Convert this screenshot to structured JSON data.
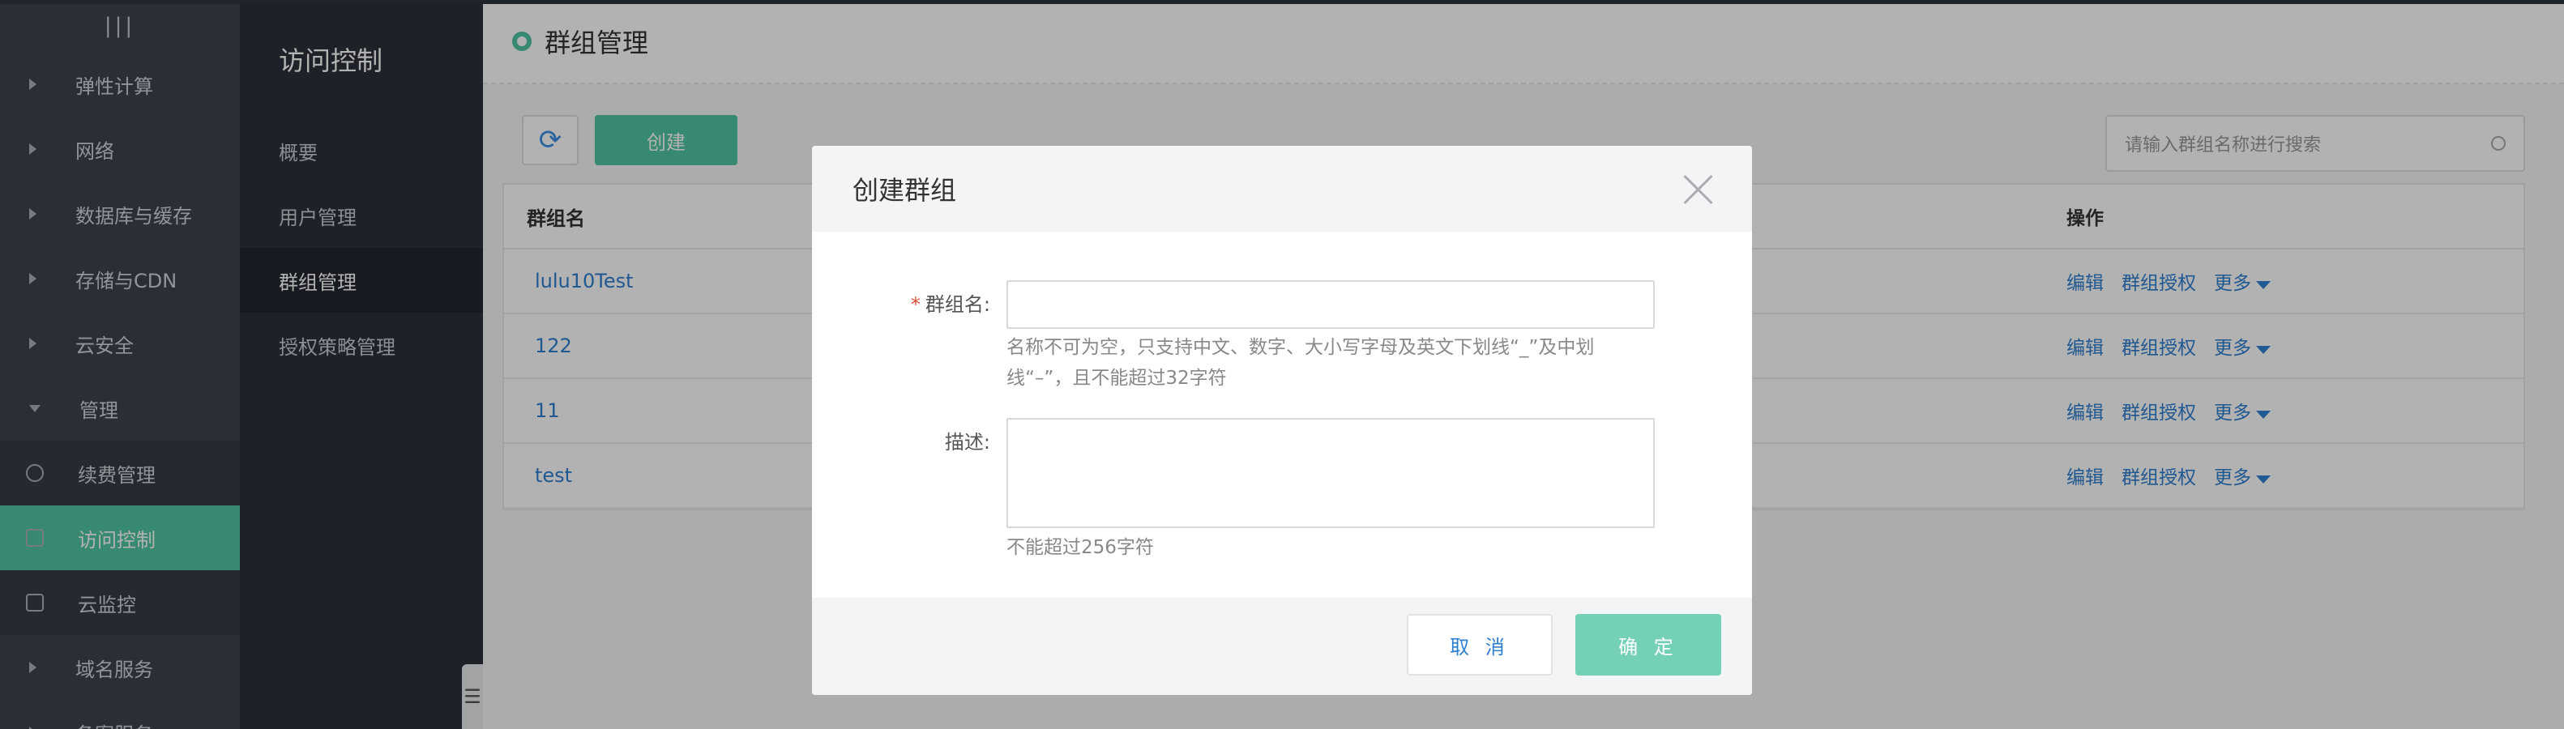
{
  "sidebar": {
    "collapse_glyph": "|||",
    "items": [
      {
        "label": "弹性计算",
        "type": "expandable"
      },
      {
        "label": "网络",
        "type": "expandable"
      },
      {
        "label": "数据库与缓存",
        "type": "expandable"
      },
      {
        "label": "存储与CDN",
        "type": "expandable"
      },
      {
        "label": "云安全",
        "type": "expandable"
      },
      {
        "label": "管理",
        "type": "expanded"
      },
      {
        "label": "续费管理",
        "type": "sub",
        "icon": "yen-circle-icon"
      },
      {
        "label": "访问控制",
        "type": "sub-active",
        "icon": "user-square-icon"
      },
      {
        "label": "云监控",
        "type": "sub",
        "icon": "monitor-icon"
      },
      {
        "label": "域名服务",
        "type": "expandable"
      },
      {
        "label": "备案服务",
        "type": "expandable"
      }
    ]
  },
  "subnav": {
    "title": "访问控制",
    "items": [
      "概要",
      "用户管理",
      "群组管理",
      "授权策略管理"
    ],
    "active_index": 2
  },
  "page": {
    "title": "群组管理",
    "create_label": "创建",
    "search_placeholder": "请输入群组名称进行搜索",
    "table": {
      "headers": {
        "name": "群组名",
        "ops": "操作"
      },
      "rows": [
        {
          "name": "lulu10Test"
        },
        {
          "name": "122"
        },
        {
          "name": "11"
        },
        {
          "name": "test"
        }
      ],
      "row_actions": {
        "edit": "编辑",
        "authorize": "群组授权",
        "more": "更多"
      }
    }
  },
  "modal": {
    "title": "创建群组",
    "fields": {
      "name_label": "群组名:",
      "required_mark": "*",
      "name_value": "",
      "name_hint": "名称不可为空，只支持中文、数字、大小写字母及英文下划线“_”及中划线“–”，且不能超过32字符",
      "desc_label": "描述:",
      "desc_value": "",
      "desc_hint": "不能超过256字符"
    },
    "cancel_label": "取 消",
    "ok_label": "确 定"
  },
  "colors": {
    "accent": "#4fc4a3",
    "link": "#2f7fd1",
    "sidebar_bg": "#3c4350",
    "subnav_bg": "#2b303a",
    "required": "#e0533b"
  }
}
